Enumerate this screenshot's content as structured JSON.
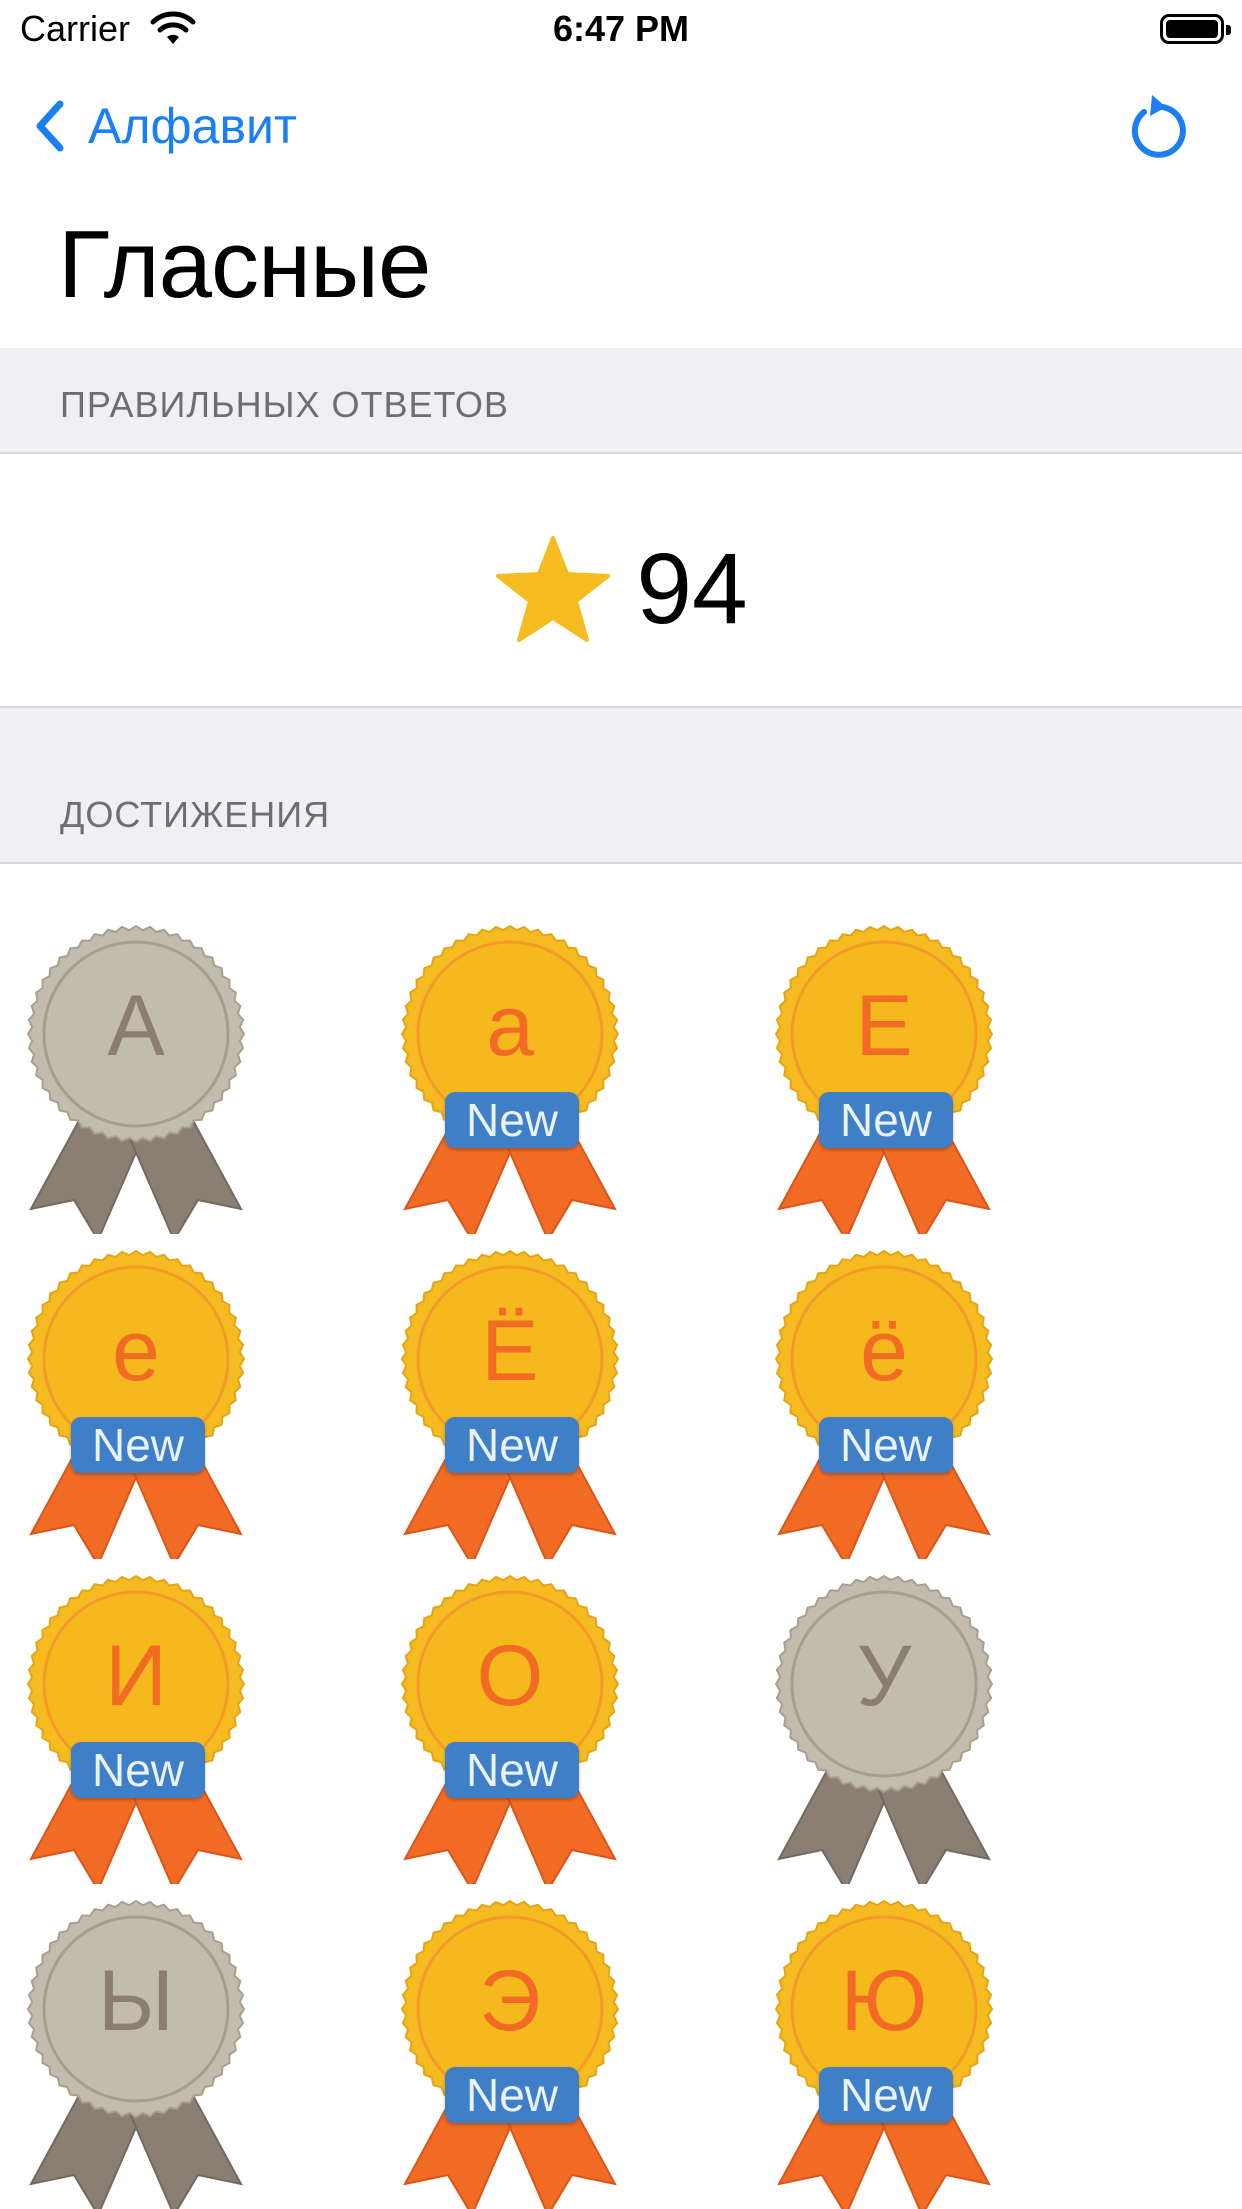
{
  "status": {
    "carrier": "Carrier",
    "time": "6:47 PM"
  },
  "nav": {
    "back_label": "Алфавит"
  },
  "title": "Гласные",
  "sections": {
    "score_header": "ПРАВИЛЬНЫХ ОТВЕТОВ",
    "achievements_header": "ДОСТИЖЕНИЯ"
  },
  "score": 94,
  "colors": {
    "accent": "#1a7ef5",
    "gold": "#f5bb21",
    "ribbon": "#f26b24",
    "badge": "#3f7fc7",
    "locked": "#c2bcae"
  },
  "achievements": [
    {
      "letter": "А",
      "earned": false,
      "badge": ""
    },
    {
      "letter": "а",
      "earned": true,
      "badge": "New"
    },
    {
      "letter": "Е",
      "earned": true,
      "badge": "New"
    },
    {
      "letter": "е",
      "earned": true,
      "badge": "New"
    },
    {
      "letter": "Ё",
      "earned": true,
      "badge": "New"
    },
    {
      "letter": "ё",
      "earned": true,
      "badge": "New"
    },
    {
      "letter": "И",
      "earned": true,
      "badge": "New"
    },
    {
      "letter": "О",
      "earned": true,
      "badge": "New"
    },
    {
      "letter": "У",
      "earned": false,
      "badge": ""
    },
    {
      "letter": "Ы",
      "earned": false,
      "badge": ""
    },
    {
      "letter": "Э",
      "earned": true,
      "badge": "New"
    },
    {
      "letter": "Ю",
      "earned": true,
      "badge": "New"
    }
  ]
}
